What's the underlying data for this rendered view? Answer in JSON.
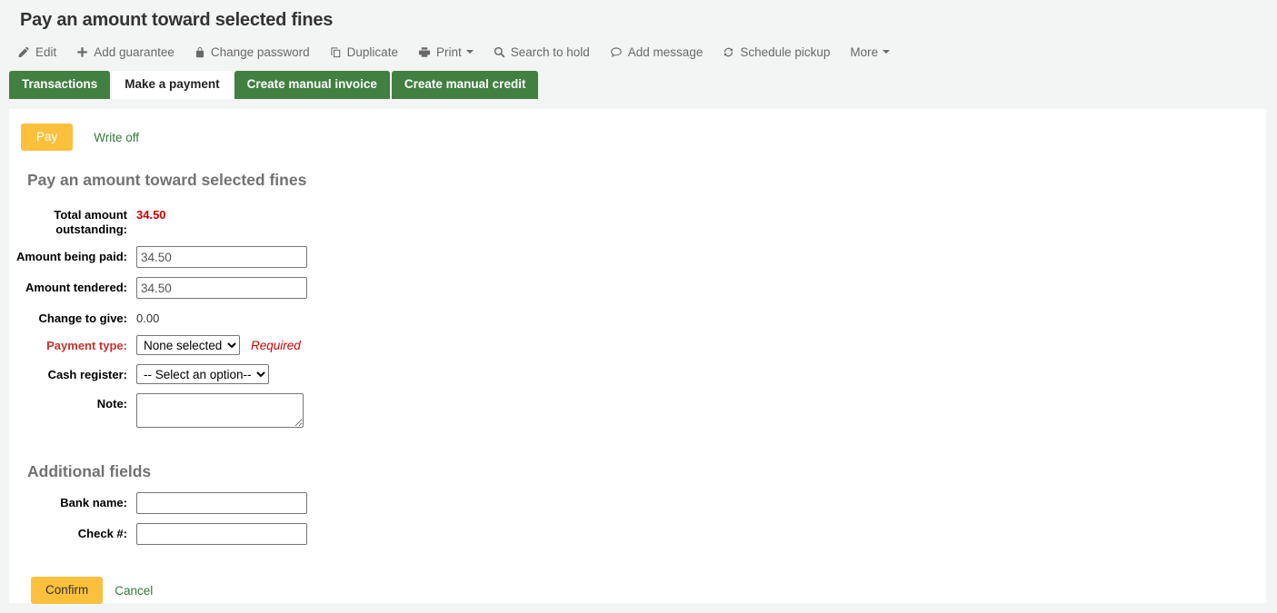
{
  "page": {
    "title": "Pay an amount toward selected fines"
  },
  "toolbar": {
    "items": [
      {
        "label": "Edit",
        "icon": "pencil-icon",
        "caret": false
      },
      {
        "label": "Add guarantee",
        "icon": "plus-icon",
        "caret": false
      },
      {
        "label": "Change password",
        "icon": "lock-icon",
        "caret": false
      },
      {
        "label": "Duplicate",
        "icon": "copy-icon",
        "caret": false
      },
      {
        "label": "Print",
        "icon": "printer-icon",
        "caret": true
      },
      {
        "label": "Search to hold",
        "icon": "search-icon",
        "caret": false
      },
      {
        "label": "Add message",
        "icon": "comment-icon",
        "caret": false
      },
      {
        "label": "Schedule pickup",
        "icon": "refresh-icon",
        "caret": false
      },
      {
        "label": "More",
        "icon": "none",
        "caret": true
      }
    ]
  },
  "tabs": [
    {
      "label": "Transactions",
      "active": false
    },
    {
      "label": "Make a payment",
      "active": true
    },
    {
      "label": "Create manual invoice",
      "active": false
    },
    {
      "label": "Create manual credit",
      "active": false
    }
  ],
  "payment_mode": {
    "pay_label": "Pay",
    "writeoff_label": "Write off"
  },
  "form": {
    "heading": "Pay an amount toward selected fines",
    "total_outstanding_label": "Total amount outstanding:",
    "total_outstanding_value": "34.50",
    "amount_paid_label": "Amount being paid:",
    "amount_paid_value": "34.50",
    "amount_tendered_label": "Amount tendered:",
    "amount_tendered_value": "34.50",
    "change_label": "Change to give:",
    "change_value": "0.00",
    "payment_type_label": "Payment type:",
    "payment_type_value": "None selected",
    "payment_type_required_hint": "Required",
    "cash_register_label": "Cash register:",
    "cash_register_value": "-- Select an option--",
    "note_label": "Note:",
    "note_value": ""
  },
  "additional": {
    "heading": "Additional fields",
    "bank_name_label": "Bank name:",
    "bank_name_value": "",
    "check_number_label": "Check #:",
    "check_number_value": ""
  },
  "footer": {
    "confirm_label": "Confirm",
    "cancel_label": "Cancel"
  },
  "colors": {
    "tab_green": "#418040",
    "button_yellow": "#fcc03c",
    "link_green": "#337a3f",
    "required_red": "#cc0000",
    "page_background": "#f3f4f4",
    "panel_background": "#ffffff"
  }
}
